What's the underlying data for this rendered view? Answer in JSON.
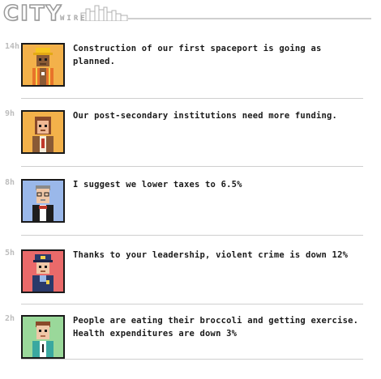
{
  "header": {
    "logo_main": "CITY",
    "logo_sub": "WIRE"
  },
  "feed": [
    {
      "time": "14h",
      "avatar": "construction-worker-icon",
      "avatar_bg": "#f3b14a",
      "text": "Construction of our first spaceport is going as planned."
    },
    {
      "time": "9h",
      "avatar": "professor-icon",
      "avatar_bg": "#f3b14a",
      "text": "Our post-secondary institutions need more funding."
    },
    {
      "time": "8h",
      "avatar": "businessman-icon",
      "avatar_bg": "#9ab8ea",
      "text": "I suggest we lower taxes to 6.5%"
    },
    {
      "time": "5h",
      "avatar": "police-officer-icon",
      "avatar_bg": "#ea6a6a",
      "text": "Thanks to your leadership, violent crime is down 12%"
    },
    {
      "time": "2h",
      "avatar": "doctor-icon",
      "avatar_bg": "#9ad89a",
      "text": "People are eating their broccoli and getting exercise.\nHealth expenditures are down 3%"
    }
  ]
}
